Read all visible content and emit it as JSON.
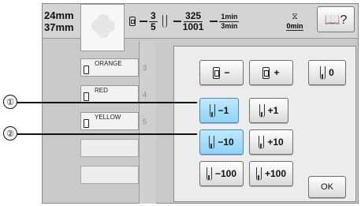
{
  "top": {
    "size_width": "24mm",
    "size_height": "37mm",
    "color_fraction_num": "3",
    "color_fraction_den": "5",
    "stitch_fraction_num": "325",
    "stitch_fraction_den": "1001",
    "time_fraction_num": "1min",
    "time_fraction_den": "3min",
    "stop_time": "0min",
    "help_icon": "help-book-icon"
  },
  "thread_list": [
    {
      "name": "ORANGE",
      "index": "3"
    },
    {
      "name": "RED",
      "index": "4"
    },
    {
      "name": "YELLOW",
      "index": "5"
    }
  ],
  "panel": {
    "color_minus_label": "−",
    "color_plus_label": "+",
    "reset_label": "0",
    "minus1_label": "−1",
    "plus1_label": "+1",
    "minus10_label": "−10",
    "plus10_label": "+10",
    "minus100_label": "−100",
    "plus100_label": "+100",
    "ok_label": "OK"
  },
  "callouts": {
    "one": "①",
    "two": "②"
  },
  "colors": {
    "active_button": "#8fd3f7",
    "screen_bg": "#c9c9c9"
  }
}
